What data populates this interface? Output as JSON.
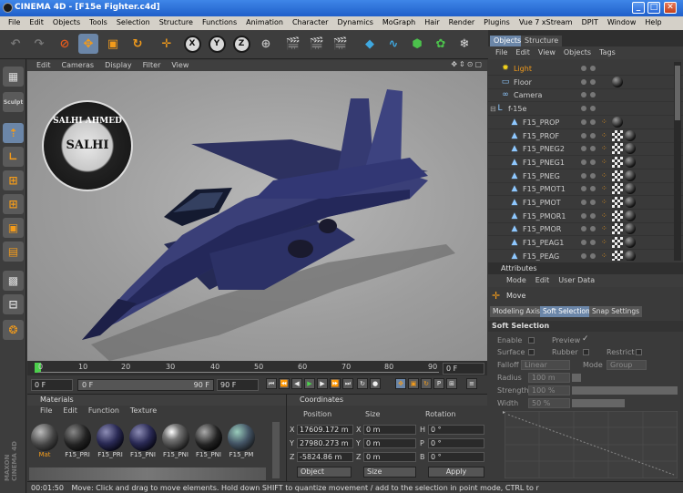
{
  "window": {
    "title": "CINEMA 4D - [F15e Fighter.c4d]",
    "min": "_",
    "max": "□",
    "close": "✕"
  },
  "menu": [
    "File",
    "Edit",
    "Objects",
    "Tools",
    "Selection",
    "Structure",
    "Functions",
    "Animation",
    "Character",
    "Dynamics",
    "MoGraph",
    "Hair",
    "Render",
    "Plugins",
    "Vue 7 xStream",
    "DPIT",
    "Window",
    "Help"
  ],
  "toolbar": {
    "axis_x": "X",
    "axis_y": "Y",
    "axis_z": "Z"
  },
  "lefttools": {
    "sculpt": "Sculpt"
  },
  "viewport": {
    "menu": [
      "Edit",
      "Cameras",
      "Display",
      "Filter",
      "View"
    ],
    "logo": {
      "top_text": "SALHI AHMED",
      "center_text": "SALHI"
    }
  },
  "timeline": {
    "ticks": [
      "0",
      "10",
      "20",
      "30",
      "40",
      "50",
      "60",
      "70",
      "80",
      "90"
    ],
    "current_frame": "0 F",
    "start_field": "0 F",
    "range_start": "0 F",
    "range_end": "90 F",
    "end_field": "90 F"
  },
  "materials": {
    "title": "Materials",
    "menu": [
      "File",
      "Edit",
      "Function",
      "Texture"
    ],
    "items": [
      {
        "label": "Mat",
        "selected": true
      },
      {
        "label": "F15_PRI",
        "selected": false
      },
      {
        "label": "F15_PRI",
        "selected": false
      },
      {
        "label": "F15_PNI",
        "selected": false
      },
      {
        "label": "F15_PNI",
        "selected": false
      },
      {
        "label": "F15_PNI",
        "selected": false
      },
      {
        "label": "F15_PM",
        "selected": false
      }
    ]
  },
  "coordinates": {
    "title": "Coordinates",
    "headers": [
      "Position",
      "Size",
      "Rotation"
    ],
    "rows": [
      {
        "axis": "X",
        "pos": "17609.172 m",
        "size": "0 m",
        "rot_axis": "H",
        "rot": "0 °"
      },
      {
        "axis": "Y",
        "pos": "27980.273 m",
        "size": "0 m",
        "rot_axis": "P",
        "rot": "0 °"
      },
      {
        "axis": "Z",
        "pos": "-5824.86 m",
        "size": "0 m",
        "rot_axis": "B",
        "rot": "0 °"
      }
    ],
    "mode": "Object",
    "size_mode": "Size",
    "apply": "Apply"
  },
  "status": {
    "time": "00:01:50",
    "message": "Move: Click and drag to move elements. Hold down SHIFT to quantize movement / add to the selection in point mode, CTRL to r"
  },
  "objects": {
    "tabs": [
      "Objects",
      "Structure"
    ],
    "menu": [
      "File",
      "Edit",
      "View",
      "Objects",
      "Tags"
    ],
    "rows": [
      {
        "name": "Light",
        "icon": "light-icon",
        "level": 1,
        "highlight": true,
        "tag": "none"
      },
      {
        "name": "Floor",
        "icon": "floor-icon",
        "level": 1,
        "highlight": false,
        "tag": "ball"
      },
      {
        "name": "Camera",
        "icon": "camera-icon",
        "level": 1,
        "highlight": false,
        "tag": "none"
      },
      {
        "name": "f-15e",
        "icon": "null-icon",
        "level": 0,
        "highlight": false,
        "tag": "none"
      },
      {
        "name": "F15_PROP",
        "icon": "polygon-icon",
        "level": 2,
        "highlight": false,
        "tag": "ball"
      },
      {
        "name": "F15_PROF",
        "icon": "polygon-icon",
        "level": 2,
        "highlight": false,
        "tag": "checker"
      },
      {
        "name": "F15_PNEG2",
        "icon": "polygon-icon",
        "level": 2,
        "highlight": false,
        "tag": "checker"
      },
      {
        "name": "F15_PNEG1",
        "icon": "polygon-icon",
        "level": 2,
        "highlight": false,
        "tag": "checker"
      },
      {
        "name": "F15_PNEG",
        "icon": "polygon-icon",
        "level": 2,
        "highlight": false,
        "tag": "checker"
      },
      {
        "name": "F15_PMOT1",
        "icon": "polygon-icon",
        "level": 2,
        "highlight": false,
        "tag": "checker"
      },
      {
        "name": "F15_PMOT",
        "icon": "polygon-icon",
        "level": 2,
        "highlight": false,
        "tag": "checker"
      },
      {
        "name": "F15_PMOR1",
        "icon": "polygon-icon",
        "level": 2,
        "highlight": false,
        "tag": "checker"
      },
      {
        "name": "F15_PMOR",
        "icon": "polygon-icon",
        "level": 2,
        "highlight": false,
        "tag": "checker"
      },
      {
        "name": "F15_PEAG1",
        "icon": "polygon-icon",
        "level": 2,
        "highlight": false,
        "tag": "checker"
      },
      {
        "name": "F15_PEAG",
        "icon": "polygon-icon",
        "level": 2,
        "highlight": false,
        "tag": "checker"
      }
    ]
  },
  "attributes": {
    "title": "Attributes",
    "menu": [
      "Mode",
      "Edit",
      "User Data"
    ],
    "tool": "Move",
    "tabs": [
      "Modeling Axis",
      "Soft Selection",
      "Snap Settings"
    ],
    "active_tab": "Soft Selection",
    "section": "Soft Selection",
    "enable": "Enable",
    "preview": "Preview",
    "surface": "Surface",
    "rubber": "Rubber",
    "restrict": "Restrict",
    "falloff": "Falloff",
    "falloff_value": "Linear",
    "mode": "Mode",
    "mode_value": "Group",
    "radius": "Radius",
    "radius_value": "100 m",
    "strength": "Strength",
    "strength_value": "100 %",
    "width": "Width",
    "width_value": "50 %"
  },
  "branding": "MAXON CINEMA 4D",
  "colors": {
    "accent": "#6b86a8",
    "highlight": "#f29b1b",
    "viewport_bg": "#a5a5a5"
  }
}
